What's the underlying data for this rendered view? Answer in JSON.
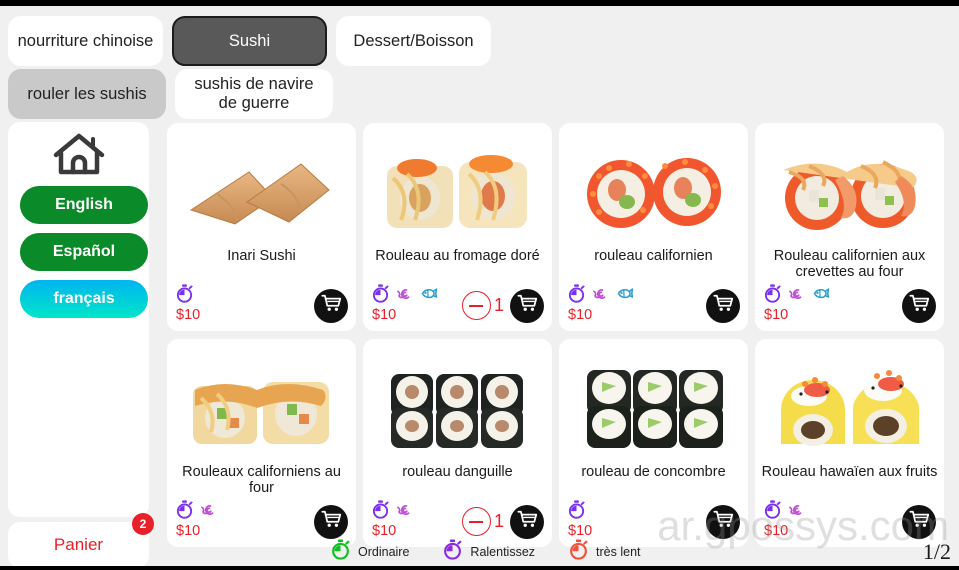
{
  "categories": {
    "primary": [
      {
        "label": "nourriture chinoise",
        "active": false
      },
      {
        "label": "Sushi",
        "active": true
      },
      {
        "label": "Dessert/Boisson",
        "active": false
      }
    ],
    "secondary": [
      {
        "label": "rouler les sushis",
        "active": true
      },
      {
        "label": "sushis de navire de guerre",
        "active": false
      }
    ]
  },
  "sidebar": {
    "home_icon": "home-icon",
    "languages": [
      {
        "label": "English",
        "style": "green"
      },
      {
        "label": "Español",
        "style": "green"
      },
      {
        "label": "français",
        "style": "cyan"
      }
    ]
  },
  "cart": {
    "label": "Panier",
    "badge": "2",
    "label_color": "#e8202a"
  },
  "products": [
    {
      "title": "Inari Sushi",
      "price": "$10",
      "icons": [
        "stopwatch-purple-icon"
      ],
      "quantity": null,
      "image": "inari-sushi-image"
    },
    {
      "title": "Rouleau au fromage doré",
      "price": "$10",
      "icons": [
        "stopwatch-purple-icon",
        "snail-icon",
        "fish-icon"
      ],
      "quantity": "1",
      "image": "golden-cheese-roll-image"
    },
    {
      "title": "rouleau californien",
      "price": "$10",
      "icons": [
        "stopwatch-purple-icon",
        "snail-icon",
        "fish-icon"
      ],
      "quantity": null,
      "image": "california-roll-image"
    },
    {
      "title": "Rouleau californien aux crevettes au four",
      "price": "$10",
      "icons": [
        "stopwatch-purple-icon",
        "snail-icon",
        "fish-icon"
      ],
      "quantity": null,
      "image": "baked-shrimp-california-roll-image"
    },
    {
      "title": "Rouleaux californiens au four",
      "price": "$10",
      "icons": [
        "stopwatch-purple-icon",
        "snail-icon"
      ],
      "quantity": null,
      "image": "baked-california-rolls-image"
    },
    {
      "title": "rouleau danguille",
      "price": "$10",
      "icons": [
        "stopwatch-purple-icon",
        "snail-icon"
      ],
      "quantity": "1",
      "image": "eel-roll-image"
    },
    {
      "title": "rouleau de concombre",
      "price": "$10",
      "icons": [
        "stopwatch-purple-icon"
      ],
      "quantity": null,
      "image": "cucumber-roll-image"
    },
    {
      "title": "Rouleau hawaïen aux fruits",
      "price": "$10",
      "icons": [
        "stopwatch-purple-icon",
        "snail-icon"
      ],
      "quantity": null,
      "image": "hawaiian-fruit-roll-image"
    }
  ],
  "legend": [
    {
      "label": "Ordinaire",
      "color": "#0ec01e",
      "icon": "stopwatch-green-icon"
    },
    {
      "label": "Ralentissez",
      "color": "#8a2be2",
      "icon": "stopwatch-purple-icon"
    },
    {
      "label": "très lent",
      "color": "#f0503c",
      "icon": "stopwatch-red-icon"
    }
  ],
  "pagination": {
    "page_indicator": "1/2"
  },
  "watermark": {
    "text": "ar.gpossys.com"
  },
  "colors": {
    "price_red": "#e8202a",
    "active_tab": "#595959",
    "lang_green": "#0a8a28",
    "background": "#f0f0f0"
  }
}
